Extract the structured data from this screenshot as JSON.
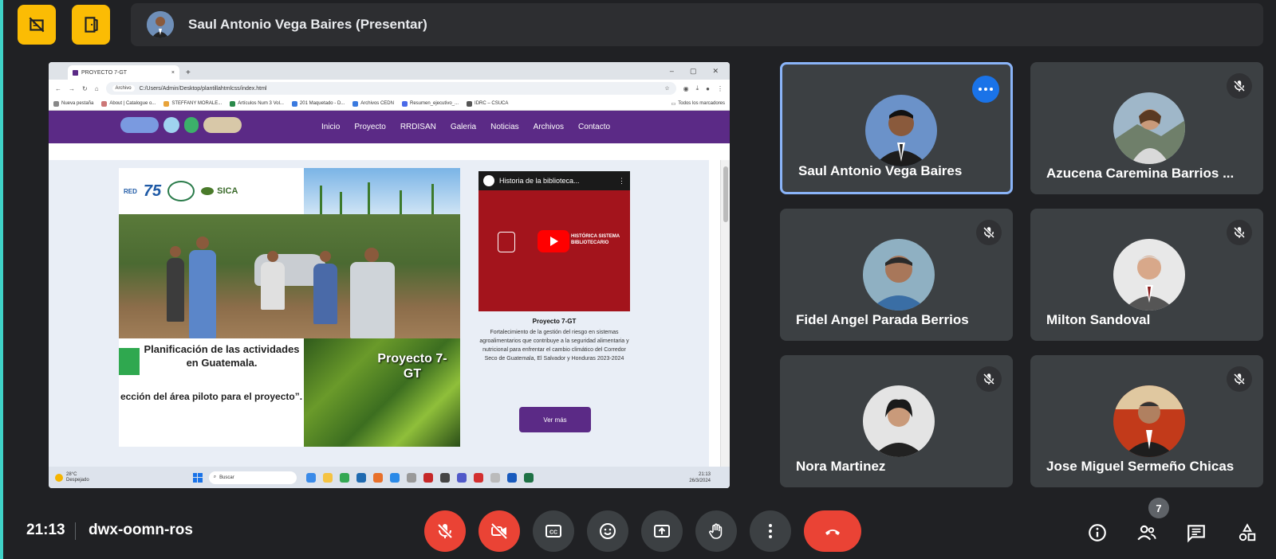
{
  "colors": {
    "background": "#202124",
    "tile": "#3c4043",
    "accent_yellow": "#fbbc04",
    "danger_red": "#ea4335",
    "active_border": "#8ab4f8",
    "site_purple": "#5b2a86"
  },
  "top_bar": {
    "left_buttons": [
      {
        "icon": "hand-raise-off-icon"
      },
      {
        "icon": "door-exit-icon"
      }
    ],
    "presenter_label": "Saul Antonio Vega Baires (Presentar)"
  },
  "shared_screen": {
    "browser": {
      "tab_title": "PROYECTO 7-GT",
      "tab_close": "×",
      "new_tab": "+",
      "window_controls": [
        "–",
        "▢",
        "✕"
      ],
      "address_chip": "Archivo",
      "address": "C:/Users/Admin/Desktop/plantillahtmlcss/index.html",
      "bookmarks": [
        "Nueva pestaña",
        "About | Catalogue o...",
        "STEFFANY MORALE...",
        "Artículos Num 3 Vol...",
        "201 Maquetado - D...",
        "Archivos CEDN",
        "Resumen_ejecutivo_...",
        "IDRC – CSUCA"
      ],
      "bookmarks_right": "Todos los marcadores"
    },
    "site": {
      "nav_links": [
        "Inicio",
        "Proyecto",
        "RRDISAN",
        "Galeria",
        "Noticias",
        "Archivos",
        "Contacto"
      ],
      "logo_75": "75",
      "logo_sica": "SICA",
      "logo_red": "RED",
      "plan_text_1": "Planificación de las actividades en Guatemala.",
      "plan_text_2": "ección del área piloto para el proyecto”.",
      "corn_text": "Proyecto 7-GT",
      "video_title": "Historia de la biblioteca...",
      "video_subtitle": "HISTÓRICA SISTEMA BIBLIOTECARIO",
      "project_title": "Proyecto 7-GT",
      "project_description": "Fortalecimiento de la gestión del riesgo en sistemas agroalimentarios que contribuye a la seguridad alimentaria y nutricional para enfrentar el cambio climático del Corredor Seco de Guatemala, El Salvador y Honduras 2023-2024",
      "cta_label": "Ver más"
    },
    "taskbar": {
      "weather_temp": "28°C",
      "weather_desc": "Despejado",
      "search_placeholder": "Buscar",
      "clock_time": "21:13",
      "clock_date": "26/3/2024"
    }
  },
  "participants": [
    {
      "name": "Saul Antonio Vega Baires",
      "state": "speaking",
      "muted": false
    },
    {
      "name": "Azucena Caremina Barrios ...",
      "muted": true
    },
    {
      "name": "Fidel Angel Parada Berrios",
      "muted": true
    },
    {
      "name": "Milton Sandoval",
      "muted": true
    },
    {
      "name": "Nora Martinez",
      "muted": true
    },
    {
      "name": "Jose Miguel Sermeño Chicas",
      "muted": true
    }
  ],
  "bottom_bar": {
    "time": "21:13",
    "meeting_code": "dwx-oomn-ros",
    "controls": [
      "mic-off-icon",
      "camera-off-icon",
      "captions-icon",
      "emoji-icon",
      "present-screen-icon",
      "raise-hand-icon",
      "more-options-icon",
      "end-call-icon"
    ],
    "participants_count": "7",
    "right_controls": [
      "info-icon",
      "people-icon",
      "chat-icon",
      "activities-icon"
    ]
  }
}
